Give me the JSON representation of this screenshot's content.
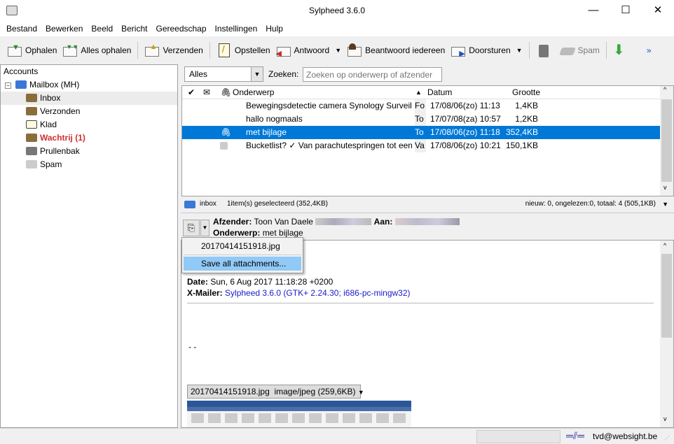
{
  "window": {
    "title": "Sylpheed 3.6.0"
  },
  "menu": [
    "Bestand",
    "Bewerken",
    "Beeld",
    "Bericht",
    "Gereedschap",
    "Instellingen",
    "Hulp"
  ],
  "toolbar": {
    "ophalen": "Ophalen",
    "alles_ophalen": "Alles ophalen",
    "verzenden": "Verzenden",
    "opstellen": "Opstellen",
    "antwoord": "Antwoord",
    "beantwoord_iedereen": "Beantwoord iedereen",
    "doorsturen": "Doorsturen",
    "spam": "Spam",
    "more": "»"
  },
  "folders": {
    "header": "Accounts",
    "mailbox": "Mailbox (MH)",
    "items": [
      "Inbox",
      "Verzonden",
      "Klad",
      "Wachtrij (1)",
      "Prullenbak",
      "Spam"
    ]
  },
  "filter": {
    "value": "Alles",
    "search_label": "Zoeken:",
    "search_placeholder": "Zoeken op onderwerp of afzender"
  },
  "list": {
    "columns": {
      "subject": "Onderwerp",
      "date": "Datum",
      "size": "Grootte"
    },
    "rows": [
      {
        "subject": "Bewegingsdetectie camera Synology Surveillance",
        "from": "Fo",
        "date": "17/08/06(zo) 11:13",
        "size": "1,4KB",
        "attach": false,
        "selected": false
      },
      {
        "subject": "hallo nogmaals",
        "from": "To",
        "date": "17/07/08(za) 10:57",
        "size": "1,2KB",
        "attach": false,
        "selected": false
      },
      {
        "subject": "met bijlage",
        "from": "To",
        "date": "17/08/06(zo) 11:18",
        "size": "352,4KB",
        "attach": true,
        "selected": true
      },
      {
        "subject": "Bucketlist? ✓ Van parachutespringen tot een",
        "from": "Va",
        "date": "17/08/06(zo) 10:21",
        "size": "150,1KB",
        "attach": false,
        "selected": false
      }
    ]
  },
  "folder_status": {
    "name": "inbox",
    "selected": "1item(s) geselecteerd (352,4KB)",
    "counts": "nieuw: 0, ongelezen:0, totaal: 4 (505,1KB)"
  },
  "message": {
    "from_label": "Afzender:",
    "from": "Toon Van Daele",
    "to_label": "Aan:",
    "subject_label": "Onderwerp:",
    "subject": "met bijlage",
    "date_label": "Date:",
    "date": "Sun, 6 Aug 2017 11:18:28 +0200",
    "xmailer_label": "X-Mailer:",
    "xmailer": "Sylpheed 3.6.0 (GTK+ 2.24.30; i686-pc-mingw32)",
    "signature": "- -",
    "attachment_button": "20170414151918.jpg  image/jpeg (259,6KB)"
  },
  "attach_menu": {
    "items": [
      "20170414151918.jpg",
      "Save all attachments..."
    ]
  },
  "statusbar": {
    "account": "tvd@websight.be"
  }
}
